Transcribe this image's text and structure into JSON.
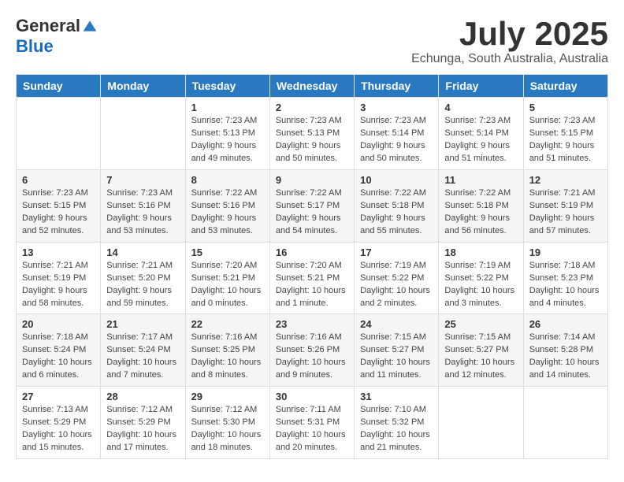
{
  "header": {
    "logo_general": "General",
    "logo_blue": "Blue",
    "month_title": "July 2025",
    "location": "Echunga, South Australia, Australia"
  },
  "days_of_week": [
    "Sunday",
    "Monday",
    "Tuesday",
    "Wednesday",
    "Thursday",
    "Friday",
    "Saturday"
  ],
  "weeks": [
    [
      {
        "day": "",
        "info": ""
      },
      {
        "day": "",
        "info": ""
      },
      {
        "day": "1",
        "info": "Sunrise: 7:23 AM\nSunset: 5:13 PM\nDaylight: 9 hours and 49 minutes."
      },
      {
        "day": "2",
        "info": "Sunrise: 7:23 AM\nSunset: 5:13 PM\nDaylight: 9 hours and 50 minutes."
      },
      {
        "day": "3",
        "info": "Sunrise: 7:23 AM\nSunset: 5:14 PM\nDaylight: 9 hours and 50 minutes."
      },
      {
        "day": "4",
        "info": "Sunrise: 7:23 AM\nSunset: 5:14 PM\nDaylight: 9 hours and 51 minutes."
      },
      {
        "day": "5",
        "info": "Sunrise: 7:23 AM\nSunset: 5:15 PM\nDaylight: 9 hours and 51 minutes."
      }
    ],
    [
      {
        "day": "6",
        "info": "Sunrise: 7:23 AM\nSunset: 5:15 PM\nDaylight: 9 hours and 52 minutes."
      },
      {
        "day": "7",
        "info": "Sunrise: 7:23 AM\nSunset: 5:16 PM\nDaylight: 9 hours and 53 minutes."
      },
      {
        "day": "8",
        "info": "Sunrise: 7:22 AM\nSunset: 5:16 PM\nDaylight: 9 hours and 53 minutes."
      },
      {
        "day": "9",
        "info": "Sunrise: 7:22 AM\nSunset: 5:17 PM\nDaylight: 9 hours and 54 minutes."
      },
      {
        "day": "10",
        "info": "Sunrise: 7:22 AM\nSunset: 5:18 PM\nDaylight: 9 hours and 55 minutes."
      },
      {
        "day": "11",
        "info": "Sunrise: 7:22 AM\nSunset: 5:18 PM\nDaylight: 9 hours and 56 minutes."
      },
      {
        "day": "12",
        "info": "Sunrise: 7:21 AM\nSunset: 5:19 PM\nDaylight: 9 hours and 57 minutes."
      }
    ],
    [
      {
        "day": "13",
        "info": "Sunrise: 7:21 AM\nSunset: 5:19 PM\nDaylight: 9 hours and 58 minutes."
      },
      {
        "day": "14",
        "info": "Sunrise: 7:21 AM\nSunset: 5:20 PM\nDaylight: 9 hours and 59 minutes."
      },
      {
        "day": "15",
        "info": "Sunrise: 7:20 AM\nSunset: 5:21 PM\nDaylight: 10 hours and 0 minutes."
      },
      {
        "day": "16",
        "info": "Sunrise: 7:20 AM\nSunset: 5:21 PM\nDaylight: 10 hours and 1 minute."
      },
      {
        "day": "17",
        "info": "Sunrise: 7:19 AM\nSunset: 5:22 PM\nDaylight: 10 hours and 2 minutes."
      },
      {
        "day": "18",
        "info": "Sunrise: 7:19 AM\nSunset: 5:22 PM\nDaylight: 10 hours and 3 minutes."
      },
      {
        "day": "19",
        "info": "Sunrise: 7:18 AM\nSunset: 5:23 PM\nDaylight: 10 hours and 4 minutes."
      }
    ],
    [
      {
        "day": "20",
        "info": "Sunrise: 7:18 AM\nSunset: 5:24 PM\nDaylight: 10 hours and 6 minutes."
      },
      {
        "day": "21",
        "info": "Sunrise: 7:17 AM\nSunset: 5:24 PM\nDaylight: 10 hours and 7 minutes."
      },
      {
        "day": "22",
        "info": "Sunrise: 7:16 AM\nSunset: 5:25 PM\nDaylight: 10 hours and 8 minutes."
      },
      {
        "day": "23",
        "info": "Sunrise: 7:16 AM\nSunset: 5:26 PM\nDaylight: 10 hours and 9 minutes."
      },
      {
        "day": "24",
        "info": "Sunrise: 7:15 AM\nSunset: 5:27 PM\nDaylight: 10 hours and 11 minutes."
      },
      {
        "day": "25",
        "info": "Sunrise: 7:15 AM\nSunset: 5:27 PM\nDaylight: 10 hours and 12 minutes."
      },
      {
        "day": "26",
        "info": "Sunrise: 7:14 AM\nSunset: 5:28 PM\nDaylight: 10 hours and 14 minutes."
      }
    ],
    [
      {
        "day": "27",
        "info": "Sunrise: 7:13 AM\nSunset: 5:29 PM\nDaylight: 10 hours and 15 minutes."
      },
      {
        "day": "28",
        "info": "Sunrise: 7:12 AM\nSunset: 5:29 PM\nDaylight: 10 hours and 17 minutes."
      },
      {
        "day": "29",
        "info": "Sunrise: 7:12 AM\nSunset: 5:30 PM\nDaylight: 10 hours and 18 minutes."
      },
      {
        "day": "30",
        "info": "Sunrise: 7:11 AM\nSunset: 5:31 PM\nDaylight: 10 hours and 20 minutes."
      },
      {
        "day": "31",
        "info": "Sunrise: 7:10 AM\nSunset: 5:32 PM\nDaylight: 10 hours and 21 minutes."
      },
      {
        "day": "",
        "info": ""
      },
      {
        "day": "",
        "info": ""
      }
    ]
  ]
}
